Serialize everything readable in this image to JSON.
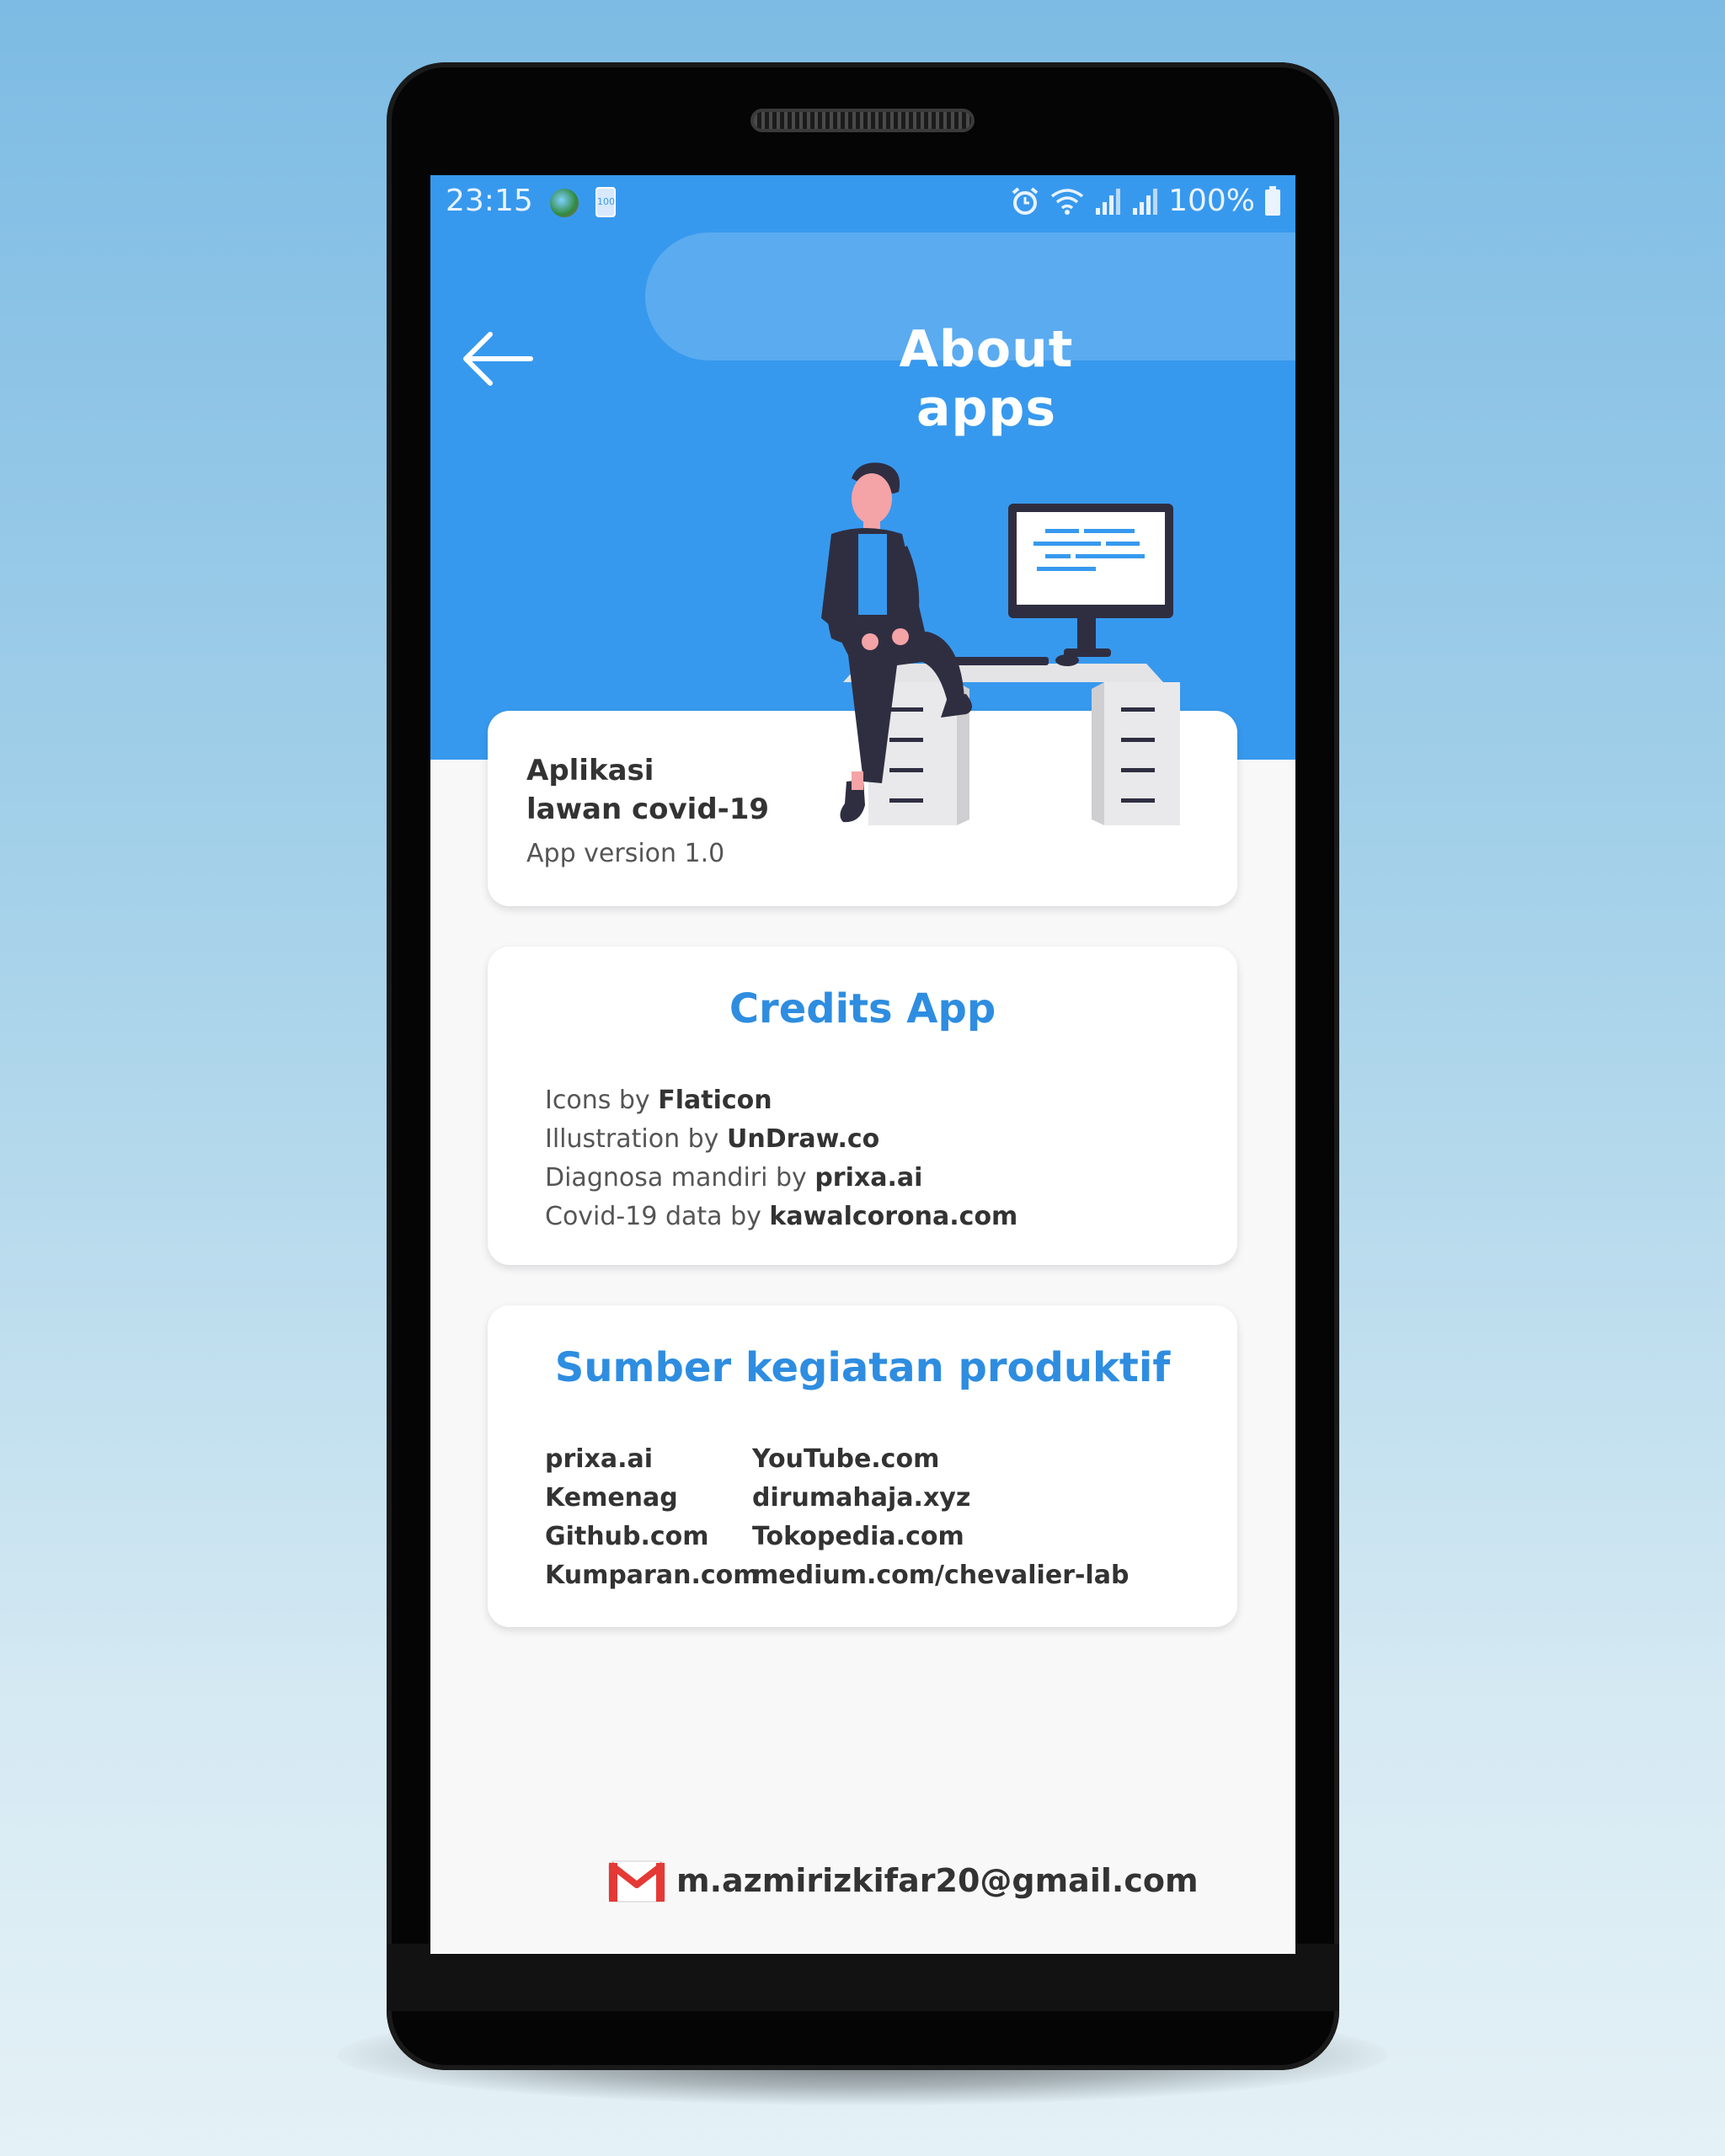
{
  "status_bar": {
    "time": "23:15",
    "notification_badge": "100",
    "battery": "100%"
  },
  "header": {
    "title": "About apps"
  },
  "app_card": {
    "name_line1": "Aplikasi",
    "name_line2": "lawan covid-19",
    "version": "App version 1.0"
  },
  "credits": {
    "heading": "Credits App",
    "lines": [
      {
        "prefix": "Icons by ",
        "source": "Flaticon"
      },
      {
        "prefix": "Illustration by ",
        "source": "UnDraw.co"
      },
      {
        "prefix": "Diagnosa mandiri by ",
        "source": "prixa.ai"
      },
      {
        "prefix": "Covid-19 data by ",
        "source": "kawalcorona.com"
      }
    ]
  },
  "sumber": {
    "heading": "Sumber kegiatan produktif",
    "left": [
      "prixa.ai",
      "Kemenag",
      "Github.com",
      "Kumparan.com"
    ],
    "right": [
      "YouTube.com",
      "dirumahaja.xyz",
      "Tokopedia.com",
      "medium.com/chevalier-lab"
    ]
  },
  "footer": {
    "email": "m.azmirizkifar20@gmail.com",
    "icon": "gmail-icon"
  },
  "colors": {
    "primary": "#3799ee",
    "header_pill": "#5aabf0",
    "heading": "#2e8de0",
    "background": "#f8f8f9"
  }
}
